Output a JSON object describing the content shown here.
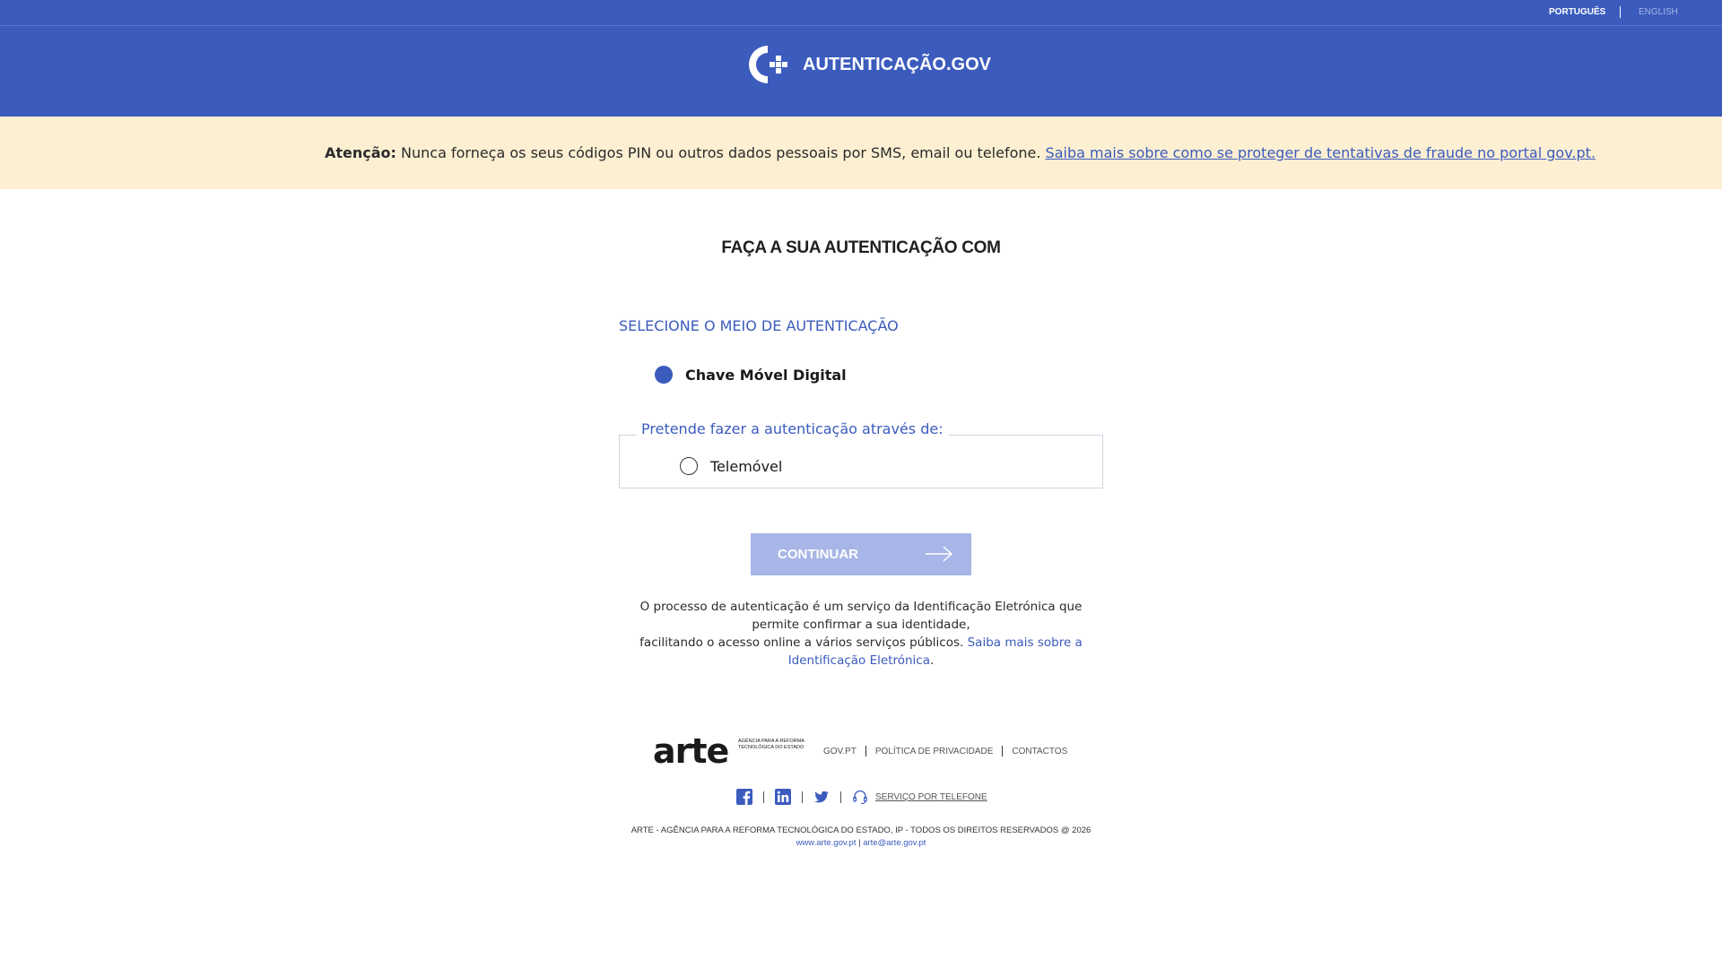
{
  "language": {
    "current": "PORTUGUÊS",
    "other": "ENGLISH"
  },
  "header": {
    "brand": "AUTENTICAÇÃO.GOV"
  },
  "warning": {
    "label": "Atenção:",
    "message": " Nunca forneça os seus códigos PIN ou outros dados pessoais por SMS, email ou telefone. ",
    "link_text": "Saiba mais sobre como se proteger de tentativas de fraude no portal gov.pt."
  },
  "main": {
    "title": "FAÇA A SUA AUTENTICAÇÃO COM",
    "section_title": "SELECIONE O MEIO DE AUTENTICAÇÃO",
    "method_option": "Chave Móvel Digital",
    "fieldset_legend": "Pretende fazer a autenticação através de:",
    "sub_option": "Telemóvel",
    "continue_label": "CONTINUAR",
    "info_line1": "O processo de autenticação é um serviço da Identificação Eletrónica que permite confirmar a sua identidade,",
    "info_line2": "facilitando o acesso online a vários serviços públicos. ",
    "info_link": "Saiba mais sobre a Identificação Eletrónica",
    "info_end": "."
  },
  "footer": {
    "logo_word": "arte",
    "logo_sub": "AGÊNCIA PARA A REFORMA TECNOLÓGICA DO ESTADO",
    "links": [
      "GOV.PT",
      "POLÍTICA DE PRIVACIDADE",
      "CONTACTOS"
    ],
    "phone_service": "SERVIÇO POR TELEFONE",
    "copyright": "ARTE - AGÊNCIA PARA A REFORMA TECNOLÓGICA DO ESTADO, IP - TODOS OS DIREITOS RESERVADOS @ 2026",
    "website": "www.arte.gov.pt",
    "email": "arte@arte.gov.pt"
  },
  "colors": {
    "brand_blue": "#3b5bbd",
    "warning_bg": "#fcefd2",
    "button_disabled": "#a7b6e6"
  },
  "icons": [
    "autenticacao-logo-icon",
    "arrow-right-icon",
    "facebook-icon",
    "linkedin-icon",
    "twitter-icon",
    "headset-icon"
  ]
}
